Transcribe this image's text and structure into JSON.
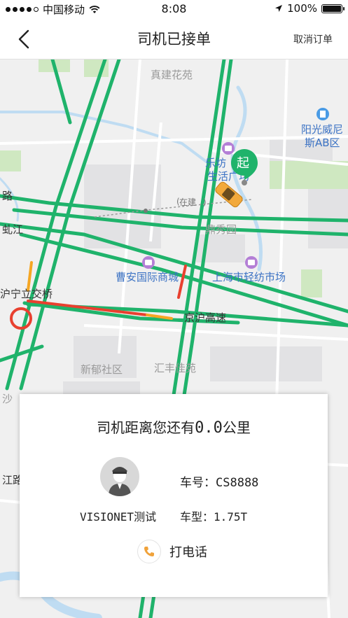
{
  "status_bar": {
    "carrier": "中国移动",
    "time": "8:08",
    "battery": "100%"
  },
  "nav": {
    "title": "司机已接单",
    "cancel_label": "取消订单"
  },
  "map": {
    "start_marker": "起",
    "under_construction": "在建",
    "places": [
      {
        "id": "zhenjian",
        "text": "真建花苑"
      },
      {
        "id": "yangguang1",
        "text": "阳光威尼"
      },
      {
        "id": "yangguang2",
        "text": "斯AB区"
      },
      {
        "id": "lefang1",
        "text": "乐坊"
      },
      {
        "id": "lefang2",
        "text": "生活广场"
      },
      {
        "id": "dingxiu",
        "text": "鼎秀园"
      },
      {
        "id": "lu",
        "text": "路"
      },
      {
        "id": "qiujiang",
        "text": "虬江"
      },
      {
        "id": "caoan",
        "text": "曹安国际商城"
      },
      {
        "id": "textile",
        "text": "上海市轻纺市场"
      },
      {
        "id": "huning",
        "text": "沪宁立交桥"
      },
      {
        "id": "jinghu",
        "text": "京沪高速"
      },
      {
        "id": "xinyu",
        "text": "新郁社区"
      },
      {
        "id": "huifeng",
        "text": "汇丰佳苑"
      },
      {
        "id": "sha",
        "text": "沙"
      },
      {
        "id": "jiang",
        "text": "江路"
      }
    ]
  },
  "card": {
    "distance_prefix": "司机距离您还有",
    "distance_value": "0.0",
    "distance_unit": "公里",
    "driver_name": "VISIONET测试",
    "plate": "车号：CS8888",
    "vehicle_type": "车型：1.75T",
    "call_label": "打电话"
  },
  "colors": {
    "road_green": "#1fb36b",
    "marker_green": "#1fb36b",
    "congestion_red": "#e8402f",
    "slow_orange": "#f5a623"
  }
}
